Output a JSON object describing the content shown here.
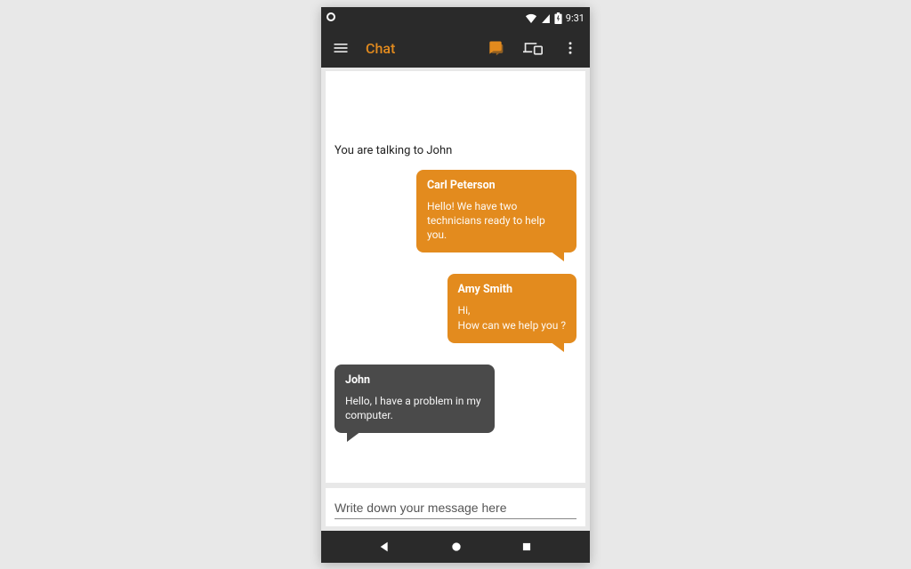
{
  "status": {
    "time": "9:31"
  },
  "appbar": {
    "title": "Chat"
  },
  "chat": {
    "talking_to": "You are talking to John",
    "messages": [
      {
        "author": "Carl Peterson",
        "text": "Hello! We have two technicians ready to help you.",
        "side": "right",
        "tone": "orange"
      },
      {
        "author": "Amy Smith",
        "text": "Hi,\nHow can we help you ?",
        "side": "right",
        "tone": "orange"
      },
      {
        "author": "John",
        "text": "Hello, I have a problem in my computer.",
        "side": "left",
        "tone": "dark"
      }
    ]
  },
  "composer": {
    "placeholder": "Write down your message here"
  },
  "colors": {
    "accent": "#e38b1e",
    "dark": "#2a2a2a",
    "bubble_dark": "#4a4a4a"
  }
}
